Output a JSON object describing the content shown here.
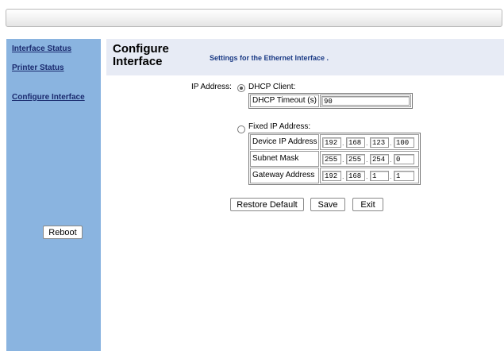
{
  "sidebar": {
    "links": [
      {
        "label": "Interface Status"
      },
      {
        "label": "Printer Status"
      },
      {
        "label": "Configure Interface"
      }
    ],
    "reboot_label": "Reboot"
  },
  "header": {
    "title": "Configure Interface",
    "subtitle": "Settings for the Ethernet Interface ."
  },
  "form": {
    "ip_address_label": "IP Address:",
    "dhcp": {
      "label": "DHCP Client:",
      "selected": true,
      "timeout_label": "DHCP Timeout (s)",
      "timeout_value": "90"
    },
    "fixed": {
      "label": "Fixed IP Address:",
      "selected": false,
      "rows": [
        {
          "label": "Device IP Address",
          "octets": [
            "192",
            "168",
            "123",
            "100"
          ]
        },
        {
          "label": "Subnet Mask",
          "octets": [
            "255",
            "255",
            "254",
            "0"
          ]
        },
        {
          "label": "Gateway Address",
          "octets": [
            "192",
            "168",
            "1",
            "1"
          ]
        }
      ]
    }
  },
  "buttons": {
    "restore": "Restore Default",
    "save": "Save",
    "exit": "Exit"
  }
}
